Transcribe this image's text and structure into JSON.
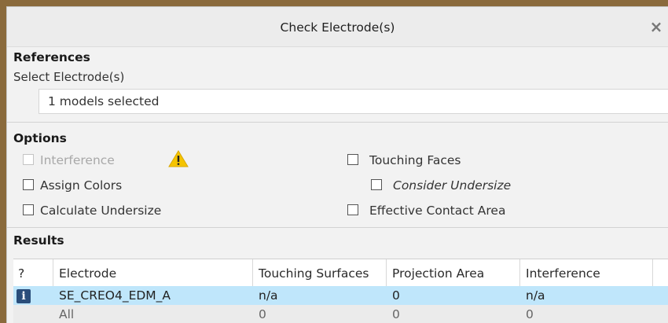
{
  "dialog": {
    "title": "Check Electrode(s)",
    "close_glyph": "×"
  },
  "references": {
    "heading": "References",
    "select_label": "Select Electrode(s)",
    "selection_value": "1 models selected"
  },
  "options": {
    "heading": "Options",
    "interference": "Interference",
    "assign_colors": "Assign Colors",
    "calculate_undersize": "Calculate Undersize",
    "touching_faces": "Touching Faces",
    "consider_undersize": "Consider Undersize",
    "effective_contact_area": "Effective Contact Area",
    "warning_icon": "warning-icon"
  },
  "results": {
    "heading": "Results",
    "columns": [
      "?",
      "Electrode",
      "Touching Surfaces",
      "Projection Area",
      "Interference"
    ],
    "rows": [
      {
        "status_icon": "i",
        "electrode": "SE_CREO4_EDM_A",
        "touching_surfaces": "n/a",
        "projection_area": "0",
        "interference": "n/a"
      },
      {
        "electrode": "All",
        "touching_surfaces": "0",
        "projection_area": "0",
        "interference": "0"
      }
    ]
  },
  "colors": {
    "selected_row": "#bfe6fb",
    "warning": "#f5c400",
    "info_icon_bg": "#2a4d7a"
  }
}
